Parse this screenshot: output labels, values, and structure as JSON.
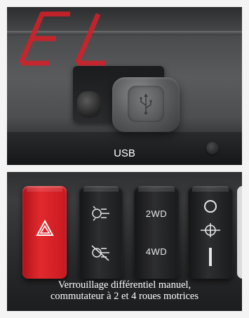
{
  "usb_photo": {
    "caption": "USB"
  },
  "switch_photo": {
    "caption_line1": "Verrouillage différentiel manuel,",
    "caption_line2": "commutateur à 2 et 4 roues motrices",
    "switches": {
      "hazard": {
        "icon": "hazard-triangle-icon"
      },
      "diff_lock": {
        "icon_top": "differential-lock-icon",
        "icon_bottom": "differential-unlock-icon"
      },
      "drive_mode": {
        "top_label": "2WD",
        "bottom_label": "4WD"
      },
      "power": {
        "icon_top": "circle-off-icon",
        "icon_middle": "axle-icon",
        "icon_bottom": "bar-on-icon"
      }
    }
  },
  "colors": {
    "hazard_switch": "#e12a2e",
    "watermark": "#d81f27",
    "caption_text": "#ffffff"
  }
}
